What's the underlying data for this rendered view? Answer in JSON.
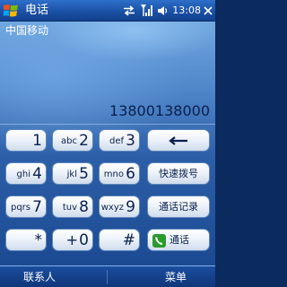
{
  "title_bar": {
    "title": "电话",
    "clock": "13:08",
    "icons": [
      "windows-start-icon",
      "sync-arrows-icon",
      "signal-strength-icon",
      "volume-icon"
    ]
  },
  "carrier": "中国移动",
  "dialed_number": "13800138000",
  "keypad": {
    "keys": [
      {
        "digit": "1",
        "letters": ""
      },
      {
        "digit": "2",
        "letters": "abc"
      },
      {
        "digit": "3",
        "letters": "def"
      },
      {
        "digit": "4",
        "letters": "ghi"
      },
      {
        "digit": "5",
        "letters": "jkl"
      },
      {
        "digit": "6",
        "letters": "mno"
      },
      {
        "digit": "7",
        "letters": "pqrs"
      },
      {
        "digit": "8",
        "letters": "tuv"
      },
      {
        "digit": "9",
        "letters": "wxyz"
      },
      {
        "digit": "*",
        "letters": ""
      },
      {
        "digit": "0",
        "letters": "+"
      },
      {
        "digit": "#",
        "letters": ""
      }
    ]
  },
  "function_keys": {
    "backspace_icon": "backspace-arrow-icon",
    "speed_dial": "快速拨号",
    "call_log": "通话记录",
    "call": "通话"
  },
  "soft_keys": {
    "left": "联系人",
    "right": "菜单"
  },
  "colors": {
    "title_bar": "#1a4fa3",
    "background_top": "#6fa6df",
    "background_bottom": "#1b4a92",
    "key_face": "#ffffff",
    "key_text": "#0a1f4d",
    "call_green": "#2a9a2a"
  }
}
